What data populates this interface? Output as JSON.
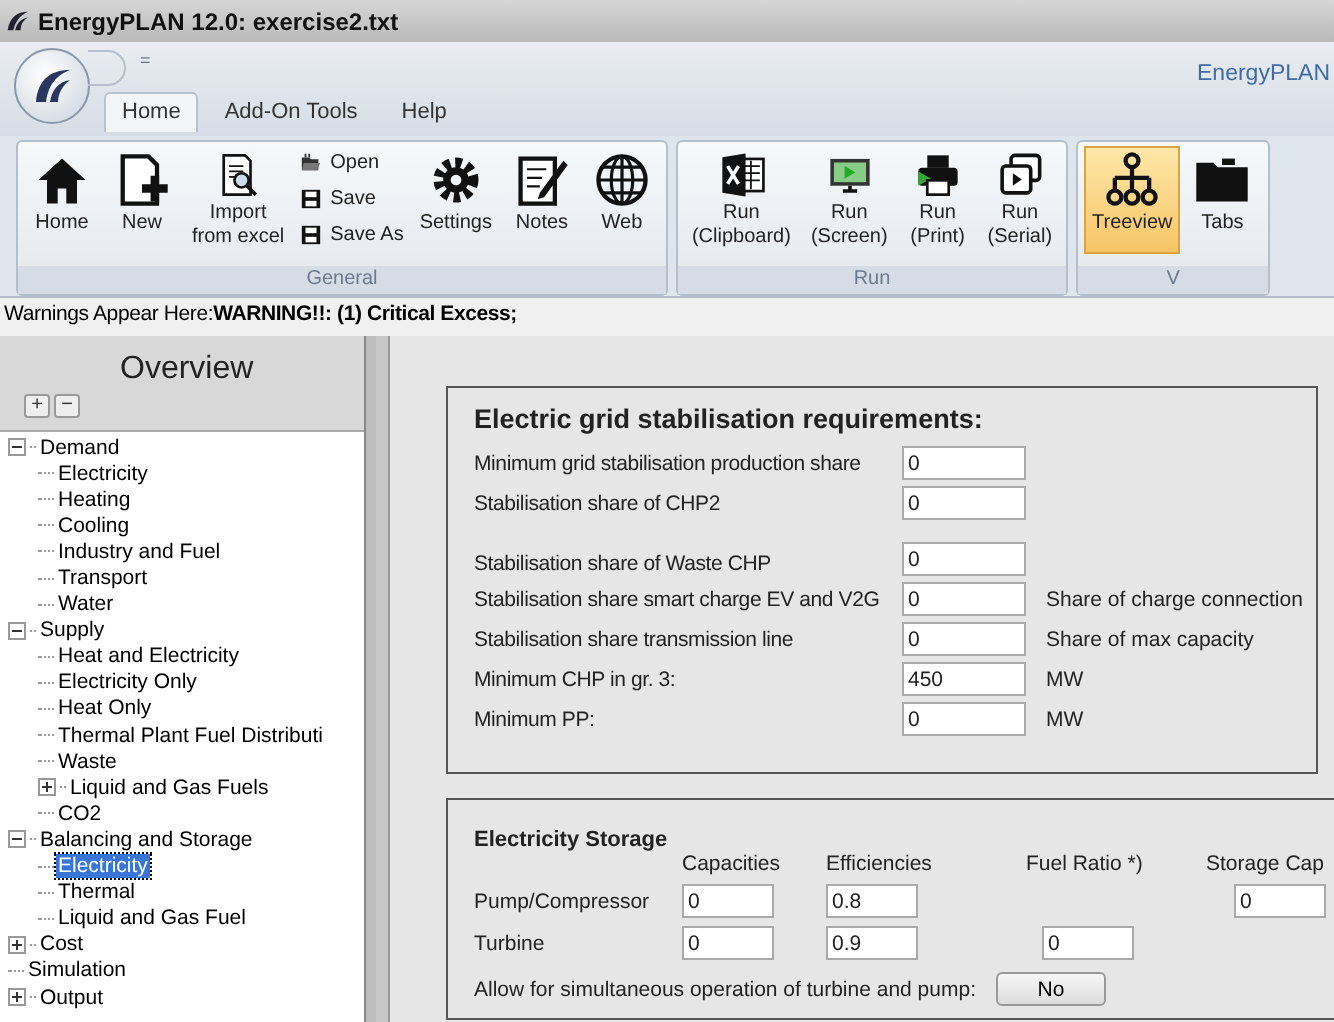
{
  "window": {
    "title": "EnergyPLAN 12.0:  exercise2.txt",
    "brand": "EnergyPLAN"
  },
  "quick_access": {
    "caret": "="
  },
  "tabs": [
    {
      "label": "Home",
      "selected": true
    },
    {
      "label": "Add-On Tools",
      "selected": false
    },
    {
      "label": "Help",
      "selected": false
    }
  ],
  "ribbon": [
    {
      "label": "General",
      "buttons": [
        {
          "kind": "large",
          "label": "Home",
          "selected": false
        },
        {
          "kind": "large",
          "label": "New",
          "selected": false
        },
        {
          "kind": "large",
          "label": "Import\nfrom excel",
          "selected": false
        },
        {
          "kind": "stack",
          "items": [
            "Open",
            "Save",
            "Save As"
          ]
        },
        {
          "kind": "large",
          "label": "Settings",
          "selected": false
        },
        {
          "kind": "large",
          "label": "Notes",
          "selected": false
        },
        {
          "kind": "large",
          "label": "Web",
          "selected": false
        }
      ]
    },
    {
      "label": "Run",
      "buttons": [
        {
          "kind": "large",
          "label": "Run\n(Clipboard)",
          "selected": false
        },
        {
          "kind": "large",
          "label": "Run\n(Screen)",
          "selected": false
        },
        {
          "kind": "large",
          "label": "Run\n(Print)",
          "selected": false
        },
        {
          "kind": "large",
          "label": "Run\n(Serial)",
          "selected": false
        }
      ]
    },
    {
      "label": "V",
      "buttons": [
        {
          "kind": "large",
          "label": "Treeview",
          "selected": true
        },
        {
          "kind": "large",
          "label": "Tabs",
          "selected": false
        }
      ]
    }
  ],
  "warnings": "Warnings Appear Here:**WARNING!!:  (1) Critical Excess;**",
  "sidebar": {
    "title": "Overview",
    "expand_all": "+",
    "collapse_all": "−",
    "items": [
      {
        "label": "Demand",
        "expanded": true,
        "selected": false,
        "children": [
          {
            "label": "Electricity",
            "selected": false
          },
          {
            "label": "Heating",
            "selected": false
          },
          {
            "label": "Cooling",
            "selected": false
          },
          {
            "label": "Industry and Fuel",
            "selected": false
          },
          {
            "label": "Transport",
            "selected": false
          },
          {
            "label": "Water",
            "selected": false
          }
        ]
      },
      {
        "label": "Supply",
        "expanded": true,
        "selected": false,
        "children": [
          {
            "label": "Heat and Electricity",
            "selected": false
          },
          {
            "label": "Electricity Only",
            "selected": false
          },
          {
            "label": "Heat Only",
            "selected": false
          },
          {
            "label": "Thermal Plant Fuel Distributi",
            "selected": false
          },
          {
            "label": "Waste",
            "selected": false
          },
          {
            "label": "Liquid and Gas Fuels",
            "expanded": false,
            "selected": false
          },
          {
            "label": "CO2",
            "selected": false
          }
        ]
      },
      {
        "label": "Balancing and Storage",
        "expanded": true,
        "selected": false,
        "children": [
          {
            "label": "Electricity",
            "selected": true
          },
          {
            "label": "Thermal",
            "selected": false
          },
          {
            "label": "Liquid and Gas Fuel",
            "selected": false
          }
        ]
      },
      {
        "label": "Cost",
        "expanded": false,
        "selected": false
      },
      {
        "label": "Simulation",
        "selected": false
      },
      {
        "label": "Output",
        "expanded": false,
        "selected": false
      }
    ]
  },
  "grid_stabilisation": {
    "title": "Electric grid stabilisation requirements:",
    "rows": [
      {
        "label": "Minimum grid stabilisation production share",
        "value": "0"
      },
      {
        "label": "Stabilisation share of CHP2",
        "value": "0"
      },
      {
        "label": "Stabilisation share of Waste CHP",
        "value": "0"
      },
      {
        "label": "Stabilisation share smart charge EV and V2G",
        "value": "0",
        "unit": "Share of charge connection"
      },
      {
        "label": "Stabilisation share transmission line",
        "value": "0",
        "unit": "Share of max capacity"
      },
      {
        "label": "Minimum CHP in gr. 3:",
        "value": "450",
        "unit": "MW"
      },
      {
        "label": "Minimum PP:",
        "value": "0",
        "unit": "MW"
      }
    ]
  },
  "electricity_storage": {
    "title": "Electricity Storage",
    "columns": [
      "Capacities",
      "Efficiencies",
      "Fuel Ratio *)",
      "Storage Cap"
    ],
    "rows": [
      {
        "label": "Pump/Compressor",
        "capacity": "0",
        "efficiency": "0.8",
        "storage_capacity": "0"
      },
      {
        "label": "Turbine",
        "capacity": "0",
        "efficiency": "0.9",
        "fuel_ratio": "0"
      }
    ],
    "simultaneous_label": "Allow for simultaneous operation of turbine and pump:",
    "simultaneous_button": "No"
  }
}
